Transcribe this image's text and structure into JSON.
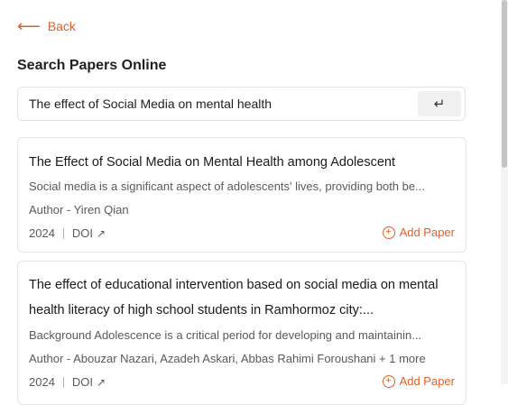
{
  "nav": {
    "back_arrow": "⟵",
    "back_label": "Back"
  },
  "page": {
    "title": "Search Papers Online"
  },
  "search": {
    "value": "The effect of Social Media on mental health",
    "submit_icon": "↵"
  },
  "results": [
    {
      "title": "The Effect of Social Media on Mental Health among Adolescent",
      "abstract": "Social media is a significant aspect of adolescents' lives, providing both be...",
      "author": "Author - Yiren Qian",
      "year": "2024",
      "doi_label": "DOI",
      "doi_icon": "↗",
      "add_label": "Add Paper",
      "add_icon": "+"
    },
    {
      "title": "The effect of educational intervention based on social media on mental health literacy of high school students in Ramhormoz city:...",
      "abstract": "Background Adolescence is a critical period for developing and maintainin...",
      "author": "Author - Abouzar Nazari, Azadeh Askari, Abbas Rahimi Foroushani + 1 more",
      "year": "2024",
      "doi_label": "DOI",
      "doi_icon": "↗",
      "add_label": "Add Paper",
      "add_icon": "+"
    }
  ],
  "colors": {
    "accent": "#e0602a",
    "text_primary": "#1f1f1f",
    "text_secondary": "#5a5a5a",
    "border": "#e6e6e6"
  }
}
